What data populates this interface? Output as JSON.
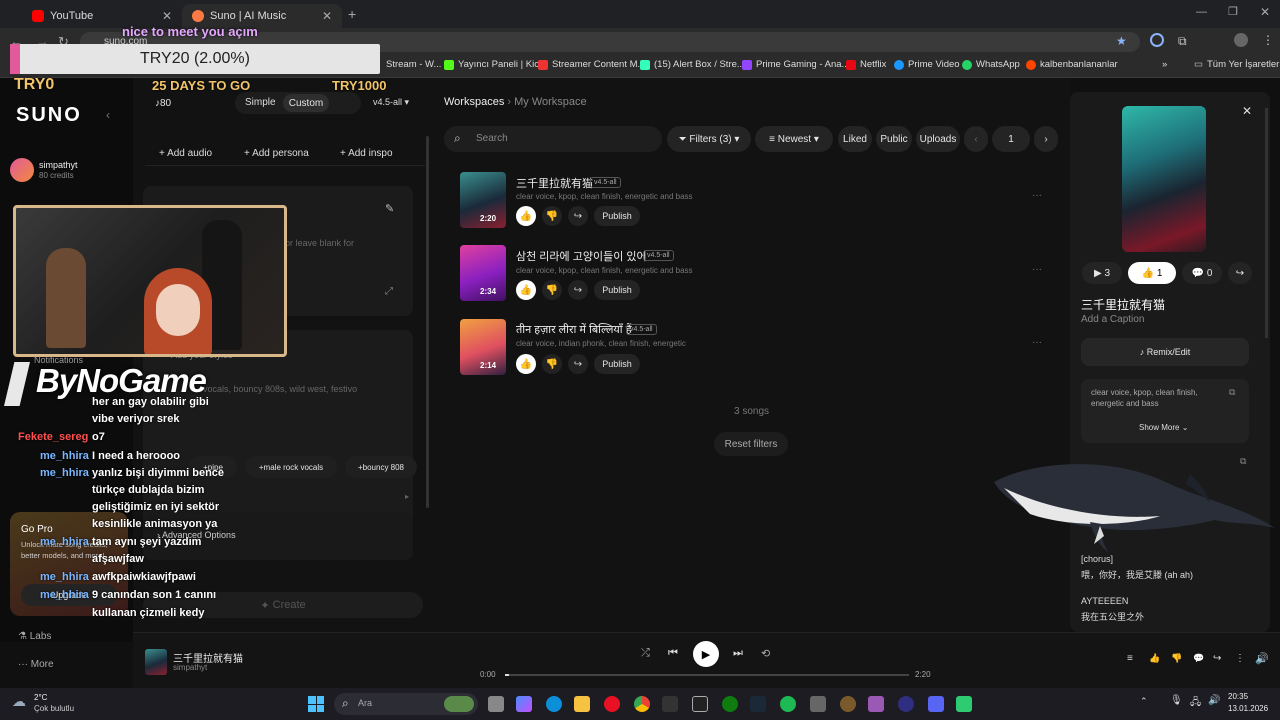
{
  "browser": {
    "tabs": [
      {
        "label": "YouTube",
        "color": "#ff0000"
      },
      {
        "label": "Suno | AI Music",
        "color": "#ff7a45"
      }
    ],
    "url": "suno.com",
    "bookmarks": [
      "Stream - W...",
      "Yayıncı Paneli | Kick",
      "Streamer Content M...",
      "(15) Alert Box / Stre...",
      "Prime Gaming - Ana...",
      "Netflix",
      "Prime Video",
      "WhatsApp",
      "kalbenbanlananlar"
    ],
    "bookmarks_more": "»",
    "all_bookmarks": "Tüm Yer İşaretleri"
  },
  "overlay": {
    "nice": "nice to meet you açım",
    "try_amount": "TRY20 (2.00%)",
    "try0": "TRY0",
    "days": "25 DAYS TO GO",
    "try1000": "TRY1000",
    "brand": "ByNoGame",
    "notifications": "Notifications"
  },
  "chat": [
    {
      "user": "",
      "msg": "her an gay olabilir gibi"
    },
    {
      "user": "",
      "msg": "vibe veriyor srek"
    },
    {
      "user": "Fekete_sereg",
      "msg": "o7"
    },
    {
      "user": "me_hhira",
      "msg": "I need a heroooo"
    },
    {
      "user": "me_hhira",
      "msg": "yanlız bişi diyimmi bence"
    },
    {
      "user": "",
      "msg": "türkçe dublajda bizim"
    },
    {
      "user": "",
      "msg": "geliştiğimiz en iyi sektör"
    },
    {
      "user": "",
      "msg": "kesinlikle animasyon ya"
    },
    {
      "user": "me_hhira",
      "msg": "tam aynı şeyi yazdım"
    },
    {
      "user": "",
      "msg": "afşawjfaw"
    },
    {
      "user": "me_hhira",
      "msg": "awfkpaiwkiawjfpawi"
    },
    {
      "user": "me_hhira",
      "msg": "9 canından son 1 canını"
    },
    {
      "user": "",
      "msg": "kullanan çizmeli kedy"
    }
  ],
  "sidebar": {
    "logo": "SUNO",
    "user": "simpathyt",
    "credits": "80 credits",
    "gopro_title": "Go Pro",
    "gopro_desc": "Unlock more song credits, better models, and more!",
    "upgrade": "Upgrade",
    "labs": "Labs",
    "more": "More"
  },
  "create": {
    "credits": "80",
    "mode_simple": "Simple",
    "mode_custom": "Custom",
    "version": "v4.5-all",
    "add_audio": "Add audio",
    "add_persona": "Add persona",
    "add_inspo": "Add inspo",
    "lyrics_hint": "or leave blank for",
    "styles_label": "Add your styles",
    "styles_hint": "vocals, bouncy 808s, wild west, festivo",
    "chips": [
      "pipe",
      "male rock vocals",
      "bouncy 808"
    ],
    "advanced": "Advanced Options",
    "create_btn": "Create"
  },
  "main": {
    "breadcrumb_root": "Workspaces",
    "breadcrumb_current": "My Workspace",
    "search_placeholder": "Search",
    "filters": "Filters (3)",
    "sort": "Newest",
    "liked": "Liked",
    "public": "Public",
    "uploads": "Uploads",
    "page": "1",
    "songs": [
      {
        "title": "三千里拉就有猫",
        "version": "v4.5-all",
        "desc": "clear voice, kpop, clean finish, energetic and bass",
        "duration": "2:20",
        "publish": "Publish"
      },
      {
        "title": "삼천 리라에 고양이들이 있어",
        "version": "v4.5-all",
        "desc": "clear voice, kpop, clean finish, energetic and bass",
        "duration": "2:34",
        "publish": "Publish"
      },
      {
        "title": "तीन हज़ार लीरा में बिल्लियाँ हैं",
        "version": "v4.5-all",
        "desc": "clear voice, indian phonk, clean finish, energetic",
        "duration": "2:14",
        "publish": "Publish"
      }
    ],
    "count": "3 songs",
    "reset": "Reset filters"
  },
  "right": {
    "plays": "3",
    "likes": "1",
    "comments": "0",
    "title": "三千里拉就有猫",
    "caption": "Add a Caption",
    "remix": "Remix/Edit",
    "style_text": "clear voice, kpop, clean finish, energetic and bass",
    "show_more": "Show More",
    "lyric1": "[chorus]",
    "lyric2": "喂，你好，我是艾滕 (ah ah)",
    "lyric3": "AYTEEEEN",
    "lyric4": "我在五公里之外"
  },
  "player": {
    "title": "三千里拉就有猫",
    "artist": "simpathyt",
    "current": "0:00",
    "total": "2:20",
    "progress": 0.01
  },
  "taskbar": {
    "temp": "2°C",
    "weather": "Çok bulutlu",
    "search": "Ara",
    "time": "20:35",
    "date": "13.01.2026"
  },
  "colors": {
    "accent": "#e35a9a",
    "bg": "#121212",
    "chat_user_red": "#ff5050",
    "chat_user_blue": "#7ab7ff"
  }
}
